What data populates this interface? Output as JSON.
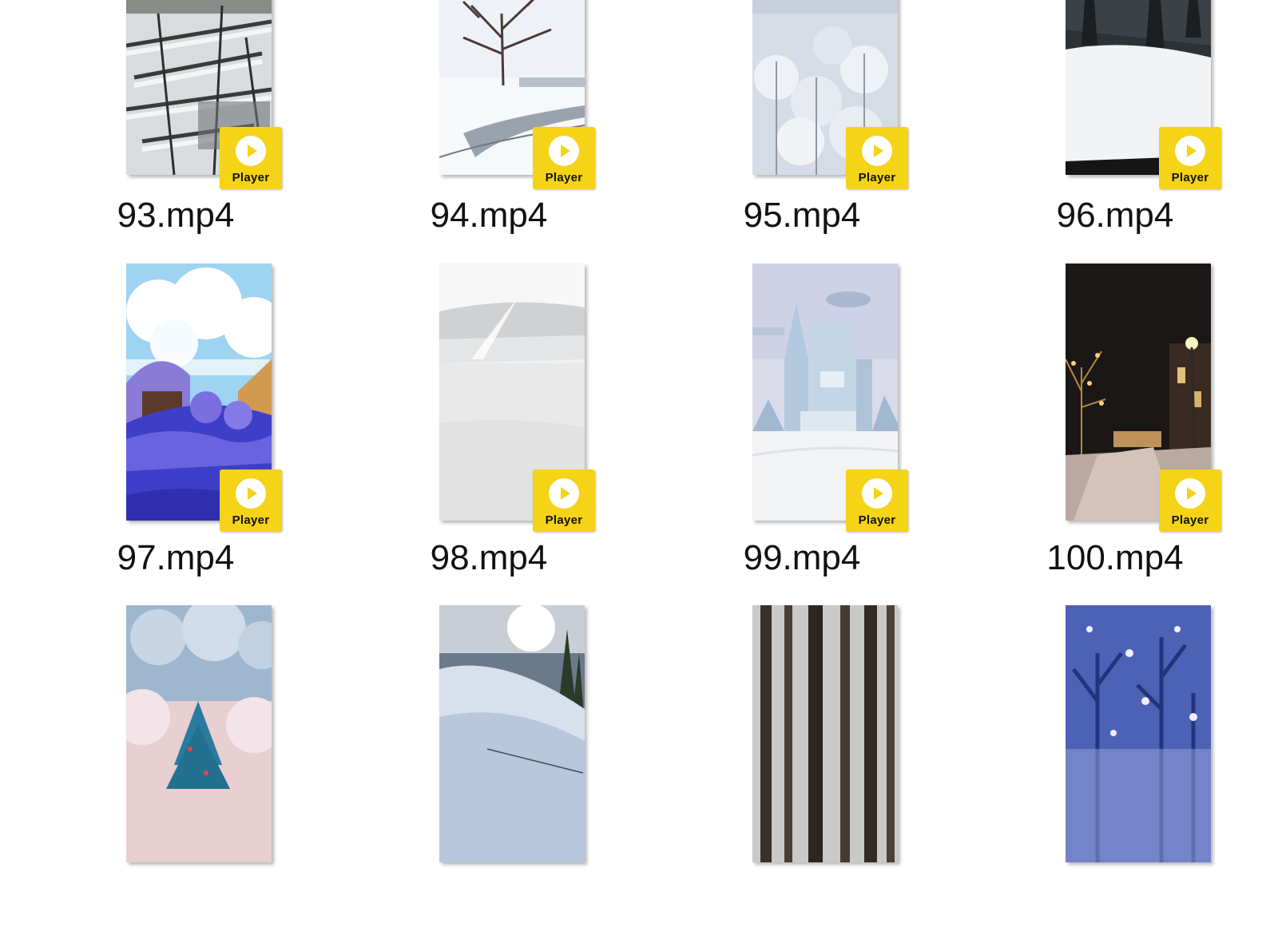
{
  "badge": {
    "label": "Player",
    "icon": "play-icon",
    "color": "#f5d316"
  },
  "files": [
    {
      "name": "93.mp4",
      "thumb": "snowy-branches-stream"
    },
    {
      "name": "94.mp4",
      "thumb": "snowy-tree-road"
    },
    {
      "name": "95.mp4",
      "thumb": "frosted-forest"
    },
    {
      "name": "96.mp4",
      "thumb": "snow-roof-pines"
    },
    {
      "name": "97.mp4",
      "thumb": "snow-village-blue"
    },
    {
      "name": "98.mp4",
      "thumb": "white-snowfield"
    },
    {
      "name": "99.mp4",
      "thumb": "ice-castle"
    },
    {
      "name": "100.mp4",
      "thumb": "night-street-snow"
    },
    {
      "name": "",
      "thumb": "christmas-tree-snow"
    },
    {
      "name": "",
      "thumb": "sunny-snow-slope"
    },
    {
      "name": "",
      "thumb": "dark-snowy-forest"
    },
    {
      "name": "",
      "thumb": "blue-snowflake-forest"
    }
  ]
}
